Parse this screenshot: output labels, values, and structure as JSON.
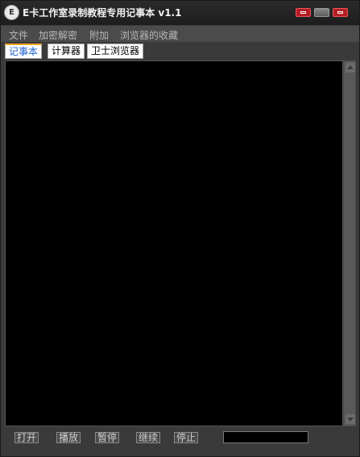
{
  "window": {
    "title": "E卡工作室录制教程专用记事本 v1.1",
    "app_icon": "E"
  },
  "menubar": {
    "items": [
      {
        "label": "文件"
      },
      {
        "label": "加密解密"
      },
      {
        "label": "附加"
      },
      {
        "label": "浏览器的收藏"
      }
    ]
  },
  "tabs": [
    {
      "label": "记事本",
      "active": true
    },
    {
      "label": "计算器",
      "active": false
    },
    {
      "label": "卫士浏览器",
      "active": false
    }
  ],
  "editor": {
    "content": ""
  },
  "toolbar": {
    "buttons": [
      {
        "label": "打开"
      },
      {
        "label": "播放"
      },
      {
        "label": "暂停"
      },
      {
        "label": "继续"
      },
      {
        "label": "停止"
      }
    ],
    "status_value": ""
  },
  "colors": {
    "accent_tab": "#1a5fd1",
    "tab_indicator": "#f5a623",
    "window_button_red": "#b61e25"
  }
}
